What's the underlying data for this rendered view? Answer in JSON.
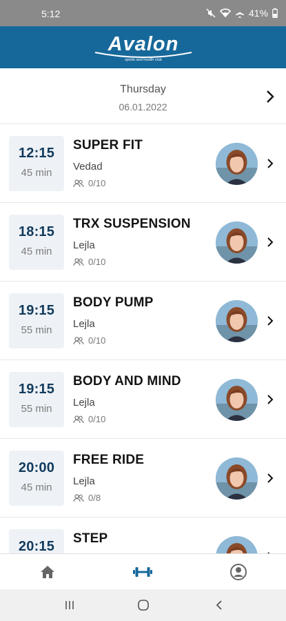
{
  "status_bar": {
    "time": "5:12",
    "battery": "41%",
    "icons": [
      "mute-icon",
      "wifi-icon",
      "airplane-icon",
      "battery-icon"
    ]
  },
  "brand": {
    "logo_text": "Avalon",
    "logo_subtitle": "sports and health club",
    "color": "#17689a"
  },
  "date_header": {
    "day": "Thursday",
    "date": "06.01.2022"
  },
  "classes": [
    {
      "time": "12:15",
      "duration": "45 min",
      "name": "SUPER FIT",
      "coach": "Vedad",
      "capacity": "0/10"
    },
    {
      "time": "18:15",
      "duration": "45 min",
      "name": "TRX SUSPENSION",
      "coach": "Lejla",
      "capacity": "0/10"
    },
    {
      "time": "19:15",
      "duration": "55 min",
      "name": "BODY PUMP",
      "coach": "Lejla",
      "capacity": "0/10"
    },
    {
      "time": "19:15",
      "duration": "55 min",
      "name": "BODY AND MIND",
      "coach": "Lejla",
      "capacity": "0/10"
    },
    {
      "time": "20:00",
      "duration": "45 min",
      "name": "FREE RIDE",
      "coach": "Lejla",
      "capacity": "0/8"
    },
    {
      "time": "20:15",
      "duration": "",
      "name": "STEP",
      "coach": "",
      "capacity": ""
    }
  ],
  "bottom_nav": {
    "items": [
      {
        "icon": "home-icon",
        "active": false
      },
      {
        "icon": "dumbbell-icon",
        "active": true
      },
      {
        "icon": "profile-icon",
        "active": false
      }
    ],
    "active_color": "#17689a",
    "inactive_color": "#666666"
  },
  "system_nav": [
    "recent-apps-icon",
    "home-circle-icon",
    "back-icon"
  ]
}
